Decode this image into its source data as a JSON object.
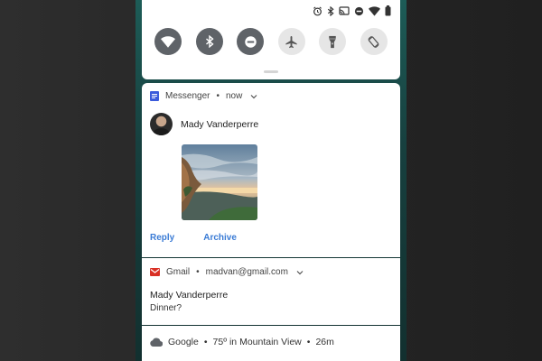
{
  "status_bar": {
    "icons": [
      "alarm-icon",
      "bluetooth-icon",
      "cast-icon",
      "do-not-disturb-icon",
      "wifi-icon",
      "battery-icon"
    ]
  },
  "quick_settings": {
    "tiles": [
      {
        "icon": "wifi-icon",
        "active": true
      },
      {
        "icon": "bluetooth-icon",
        "active": true
      },
      {
        "icon": "do-not-disturb-icon",
        "active": true
      },
      {
        "icon": "airplane-icon",
        "active": false
      },
      {
        "icon": "flashlight-icon",
        "active": false
      },
      {
        "icon": "auto-rotate-icon",
        "active": false
      }
    ]
  },
  "notifications": {
    "messenger": {
      "app": "Messenger",
      "dot": "•",
      "time": "now",
      "sender": "Mady Vanderperre",
      "actions": {
        "reply": "Reply",
        "archive": "Archive"
      }
    },
    "gmail": {
      "app": "Gmail",
      "dot": "•",
      "account": "madvan@gmail.com",
      "title": "Mady Vanderperre",
      "body": "Dinner?"
    },
    "google": {
      "app": "Google",
      "dot1": "•",
      "weather": "75º in Mountain View",
      "dot2": "•",
      "time": "26m"
    }
  },
  "colors": {
    "accent": "#3a7bd5",
    "active_tile": "#5f6368",
    "inactive_tile": "#e6e6e6",
    "messenger_icon": "#3b5bdb",
    "gmail_icon": "#d93025"
  }
}
